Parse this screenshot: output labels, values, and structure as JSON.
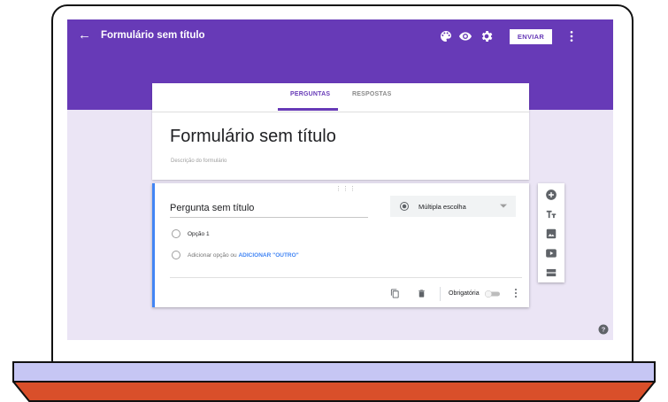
{
  "header": {
    "title": "Formulário sem título",
    "send_label": "ENVIAR",
    "icons": [
      "back-arrow-icon",
      "palette-icon",
      "eye-icon",
      "gear-icon",
      "more-vert-icon"
    ]
  },
  "tabs": [
    {
      "label": "PERGUNTAS",
      "active": true
    },
    {
      "label": "RESPOSTAS",
      "active": false
    }
  ],
  "form": {
    "title": "Formulário sem título",
    "description_placeholder": "Descrição do formulário"
  },
  "question": {
    "title": "Pergunta sem título",
    "type": "Múltipla escolha",
    "options": [
      "Opção 1"
    ],
    "add_option": "Adicionar opção",
    "add_or": " ou ",
    "add_other": "ADICIONAR \"OUTRO\"",
    "required_label": "Obrigatória",
    "required": false
  },
  "side_toolbar": [
    "add-question-icon",
    "title-text-icon",
    "image-icon",
    "video-icon",
    "section-icon"
  ],
  "colors": {
    "brand": "#673ab7",
    "accent": "#4285f4",
    "background": "#ebe5f5",
    "base_top": "#c6c6f4",
    "base_bottom": "#d94f2a"
  }
}
